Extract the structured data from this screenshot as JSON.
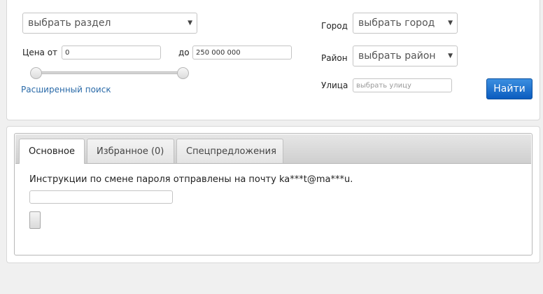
{
  "search": {
    "section_select": "выбрать раздел",
    "price_from_label": "Цена от",
    "price_from_value": "0",
    "price_to_label": "до",
    "price_to_value": "250 000 000",
    "price_slider": {
      "min_fraction": 0.0,
      "max_fraction": 1.0
    },
    "advanced_link": "Расширенный поиск",
    "city_label": "Город",
    "city_select": "выбрать город",
    "district_label": "Район",
    "district_select": "выбрать район",
    "street_label": "Улица",
    "street_placeholder": "выбрать улицу",
    "find_button": "Найти",
    "dropdown_arrow": "▼",
    "accent_color": "#0b5cbf"
  },
  "tabs": {
    "items": [
      {
        "label": "Основное",
        "active": true
      },
      {
        "label": "Избранное (0)",
        "active": false
      },
      {
        "label": "Спецпредложения",
        "active": false
      }
    ]
  },
  "content": {
    "message": "Инструкции по смене пароля отправлены на почту ka***t@ma***u.",
    "input_value": "",
    "button_label": ""
  }
}
